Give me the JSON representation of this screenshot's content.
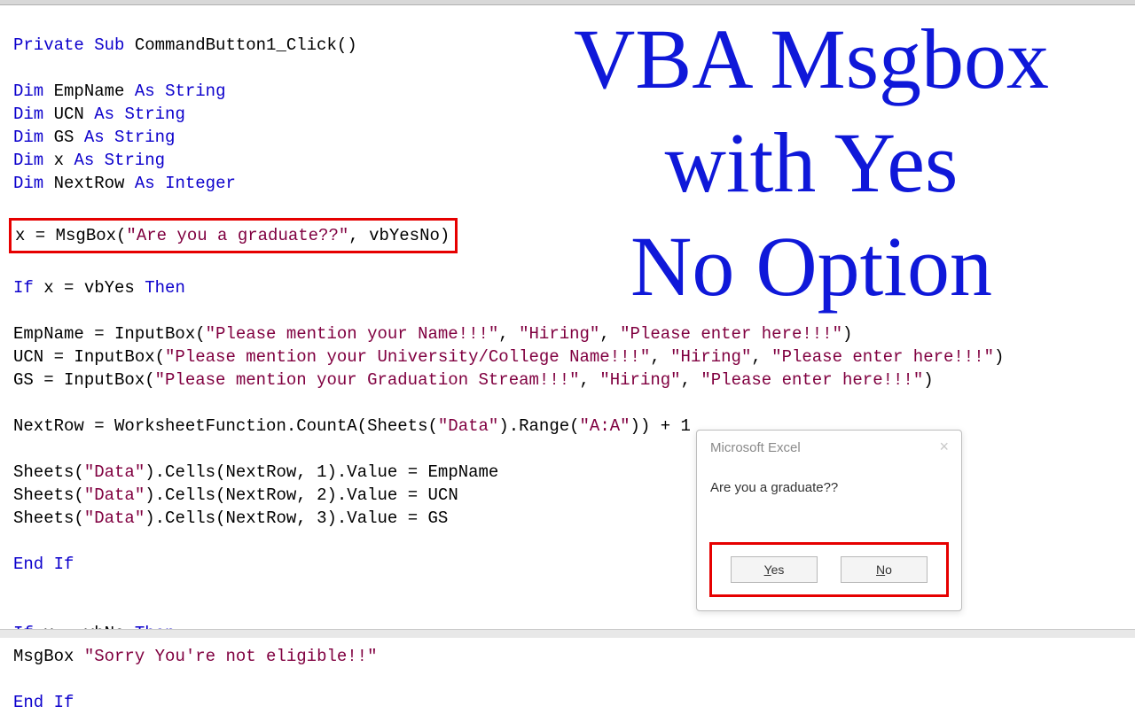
{
  "overlay": {
    "line1": "VBA Msgbox",
    "line2": "with Yes",
    "line3": "No Option"
  },
  "code": {
    "sub_kw": "Private Sub",
    "sub_name": " CommandButton1_Click()",
    "dim_kw": "Dim",
    "as_kw": "As",
    "string_kw": "String",
    "integer_kw": "Integer",
    "var_emp": " EmpName ",
    "var_ucn": " UCN ",
    "var_gs": " GS ",
    "var_x": " x ",
    "var_nextrow": " NextRow ",
    "msgbox_line_a": "x = MsgBox(",
    "msgbox_str": "\"Are you a graduate??\"",
    "msgbox_line_b": ", vbYesNo)",
    "if_kw": "If",
    "then_kw": "Then",
    "if_yes": " x = vbYes ",
    "inp_emp_a": "EmpName = InputBox(",
    "inp_emp_s1": "\"Please mention your Name!!!\"",
    "sep": ", ",
    "hiring": "\"Hiring\"",
    "enter_here": "\"Please enter here!!!\"",
    "inp_ucn_a": "UCN = InputBox(",
    "inp_ucn_s1": "\"Please mention your University/College Name!!!\"",
    "inp_gs_a": "GS = InputBox(",
    "inp_gs_s1": "\"Please mention your Graduation Stream!!!\"",
    "close_paren": ")",
    "nextrow_a": "NextRow = WorksheetFunction.CountA(Sheets(",
    "data_str": "\"Data\"",
    "nextrow_b": ").Range(",
    "aa_str": "\"A:A\"",
    "nextrow_c": ")) + 1",
    "sheets_a": "Sheets(",
    "cells_a": ").Cells(NextRow, ",
    "cells_b1": "1).Value = EmpName",
    "cells_b2": "2).Value = UCN",
    "cells_b3": "3).Value = GS",
    "endif_kw": "End If",
    "if_no": " x = vbNo ",
    "msgbox2_a": "MsgBox ",
    "msgbox2_s": "\"Sorry You're not eligible!!\""
  },
  "msgbox": {
    "title": "Microsoft Excel",
    "text": "Are you a graduate??",
    "yes": "Yes",
    "no": "No",
    "y": "Y",
    "es": "es",
    "n": "N",
    "o": "o"
  }
}
